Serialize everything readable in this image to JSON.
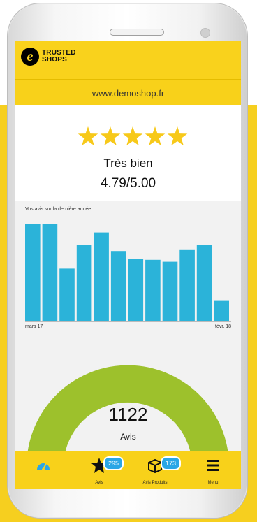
{
  "brand": {
    "name_line1": "TRUSTED",
    "name_line2": "SHOPS",
    "logo_letter": "e"
  },
  "shop": {
    "url": "www.demoshop.fr"
  },
  "rating": {
    "label": "Très bien",
    "score": "4.79/5.00",
    "stars": 5
  },
  "chart": {
    "title": "Vos avis sur la dernière année",
    "x_start": "mars 17",
    "x_end": "févr. 18"
  },
  "chart_data": {
    "type": "bar",
    "title": "Vos avis sur la dernière année",
    "xlabel": "",
    "ylabel": "",
    "categories": [
      "mars 17",
      "",
      "",
      "",
      "",
      "",
      "",
      "",
      "",
      "",
      "",
      "févr. 18"
    ],
    "values": [
      100,
      100,
      54,
      78,
      91,
      72,
      64,
      63,
      61,
      73,
      78,
      21
    ],
    "ylim": [
      0,
      110
    ],
    "grid": false,
    "colors": {
      "bar": "#2bb3d9"
    }
  },
  "gauge": {
    "value": "1122",
    "label": "Avis",
    "fill_fraction": 0.96,
    "colors": {
      "main": "#9dc12c",
      "accent": "#f3c61a"
    }
  },
  "tabs": [
    {
      "label": "",
      "icon": "gauge-icon",
      "badge": ""
    },
    {
      "label": "Avis",
      "icon": "star-icon",
      "badge": "295"
    },
    {
      "label": "Avis Produits",
      "icon": "box-icon",
      "badge": "173"
    },
    {
      "label": "Menu",
      "icon": "menu-icon",
      "badge": ""
    }
  ],
  "colors": {
    "brand_yellow": "#f9d21c",
    "star_yellow": "#f7c91a",
    "bar_blue": "#2bb3d9",
    "badge_blue": "#2aa6e6"
  }
}
